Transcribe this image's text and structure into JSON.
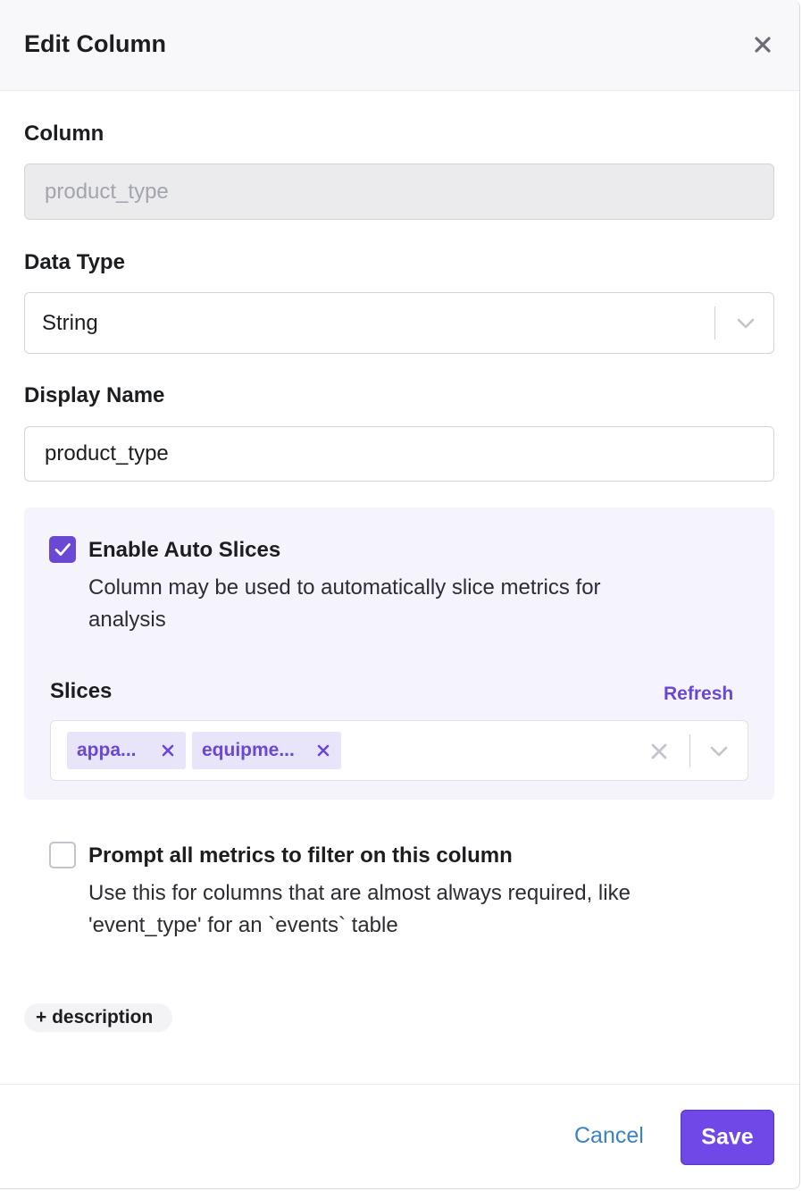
{
  "dialog": {
    "title": "Edit Column"
  },
  "column_field": {
    "label": "Column",
    "value": "product_type"
  },
  "data_type_field": {
    "label": "Data Type",
    "value": "String"
  },
  "display_name_field": {
    "label": "Display Name",
    "value": "product_type"
  },
  "auto_slices": {
    "checked": true,
    "title": "Enable Auto Slices",
    "description_line1": "Column may be used to automatically slice metrics for",
    "description_line2": "analysis",
    "slices_label": "Slices",
    "refresh_label": "Refresh",
    "chips": [
      "appa...",
      "equipme..."
    ]
  },
  "prompt_filter": {
    "checked": false,
    "title": "Prompt all metrics to filter on this column",
    "description_line1": "Use this for columns that are almost always required, like",
    "description_line2": "'event_type' for an `events` table"
  },
  "add_description_label": "+ description",
  "footer": {
    "cancel_label": "Cancel",
    "save_label": "Save"
  },
  "colors": {
    "accent": "#6b48d3",
    "save_button": "#7048e8",
    "link": "#3b82c4",
    "panel_bg": "#f5f3fb",
    "chip_bg": "#e8e4fa"
  },
  "icons": [
    "close-icon",
    "chevron-down-icon",
    "checkmark-icon",
    "chip-remove-icon",
    "clear-icon"
  ]
}
